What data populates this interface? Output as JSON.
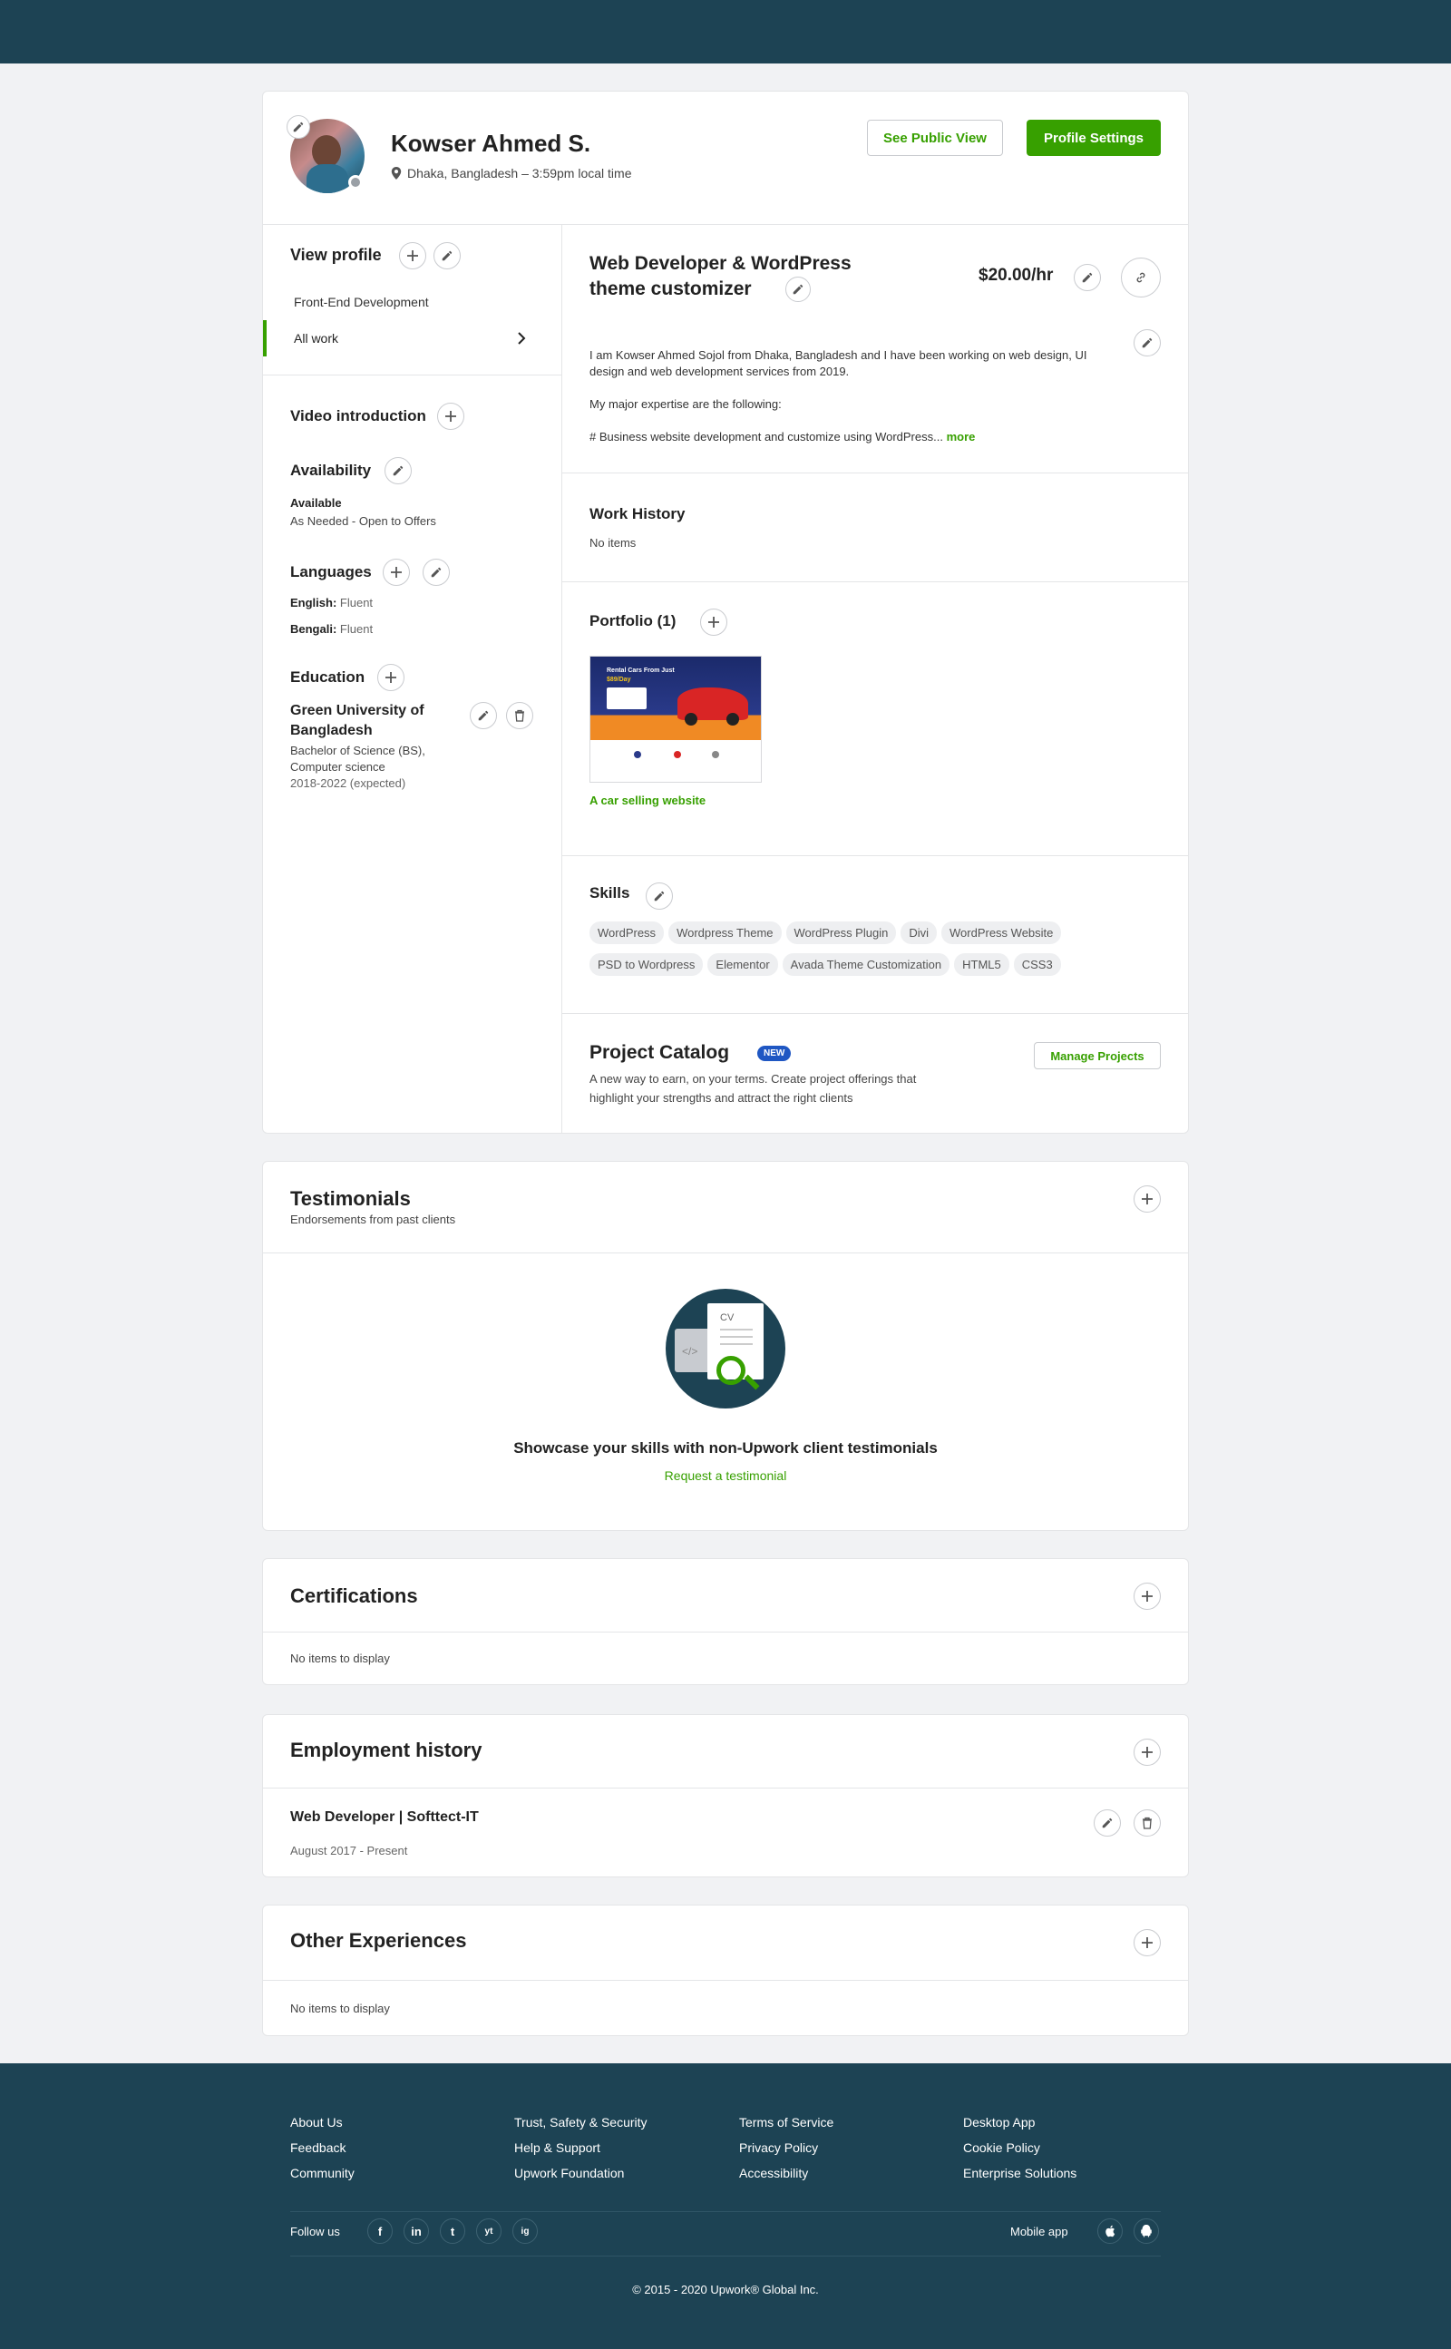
{
  "colors": {
    "brand": "#37a000",
    "header": "#1d4354",
    "badge_blue": "#1f57c3"
  },
  "profile": {
    "name": "Kowser Ahmed S.",
    "location": "Dhaka, Bangladesh – 3:59pm local time",
    "see_public_view": "See Public View",
    "profile_settings": "Profile Settings"
  },
  "sidebar": {
    "view_profile": "View profile",
    "items": [
      {
        "label": "Front-End Development"
      },
      {
        "label": "All work"
      }
    ],
    "video_intro": "Video introduction",
    "availability": {
      "title": "Availability",
      "status": "Available",
      "detail": "As Needed - Open to Offers"
    },
    "languages": {
      "title": "Languages",
      "list": [
        {
          "name": "English:",
          "level": "Fluent"
        },
        {
          "name": "Bengali:",
          "level": "Fluent"
        }
      ]
    },
    "education": {
      "title": "Education",
      "school_line1": "Green University of",
      "school_line2": "Bangladesh",
      "degree_line1": "Bachelor of Science (BS),",
      "degree_line2": "Computer science",
      "years": "2018-2022 (expected)"
    }
  },
  "main": {
    "title_line1": "Web Developer & WordPress",
    "title_line2": "theme customizer",
    "rate": "$20.00/hr",
    "overview_p1": "I am Kowser Ahmed Sojol from Dhaka, Bangladesh and I have been working on web design, UI design and web development services from 2019.",
    "overview_p2": "My major expertise are the following:",
    "overview_p3": "# Business website development and customize using WordPress...",
    "more": "more",
    "work_history": {
      "title": "Work History",
      "empty": "No items"
    },
    "portfolio": {
      "title": "Portfolio (1)",
      "item_title": "A car selling website",
      "thumb_text": "Rental Cars From Just",
      "thumb_price": "$89/Day"
    },
    "skills": {
      "title": "Skills",
      "row1": [
        "WordPress",
        "Wordpress Theme",
        "WordPress Plugin",
        "Divi",
        "WordPress Website"
      ],
      "row2": [
        "PSD to Wordpress",
        "Elementor",
        "Avada Theme Customization",
        "HTML5",
        "CSS3"
      ]
    },
    "project_catalog": {
      "title": "Project Catalog",
      "badge": "NEW",
      "desc_line1": "A new way to earn, on your terms. Create project offerings that",
      "desc_line2": "highlight your strengths and attract the right clients",
      "manage": "Manage Projects"
    }
  },
  "testimonials": {
    "title": "Testimonials",
    "subtitle": "Endorsements from past clients",
    "cv_label": "CV",
    "heading": "Showcase your skills with non-Upwork client testimonials",
    "link": "Request a testimonial"
  },
  "certifications": {
    "title": "Certifications",
    "empty": "No items to display"
  },
  "employment": {
    "title": "Employment history",
    "job": "Web Developer | Softtect-IT",
    "dates": "August 2017 - Present"
  },
  "other": {
    "title": "Other Experiences",
    "empty": "No items to display"
  },
  "footer": {
    "col1": [
      "About Us",
      "Feedback",
      "Community"
    ],
    "col2": [
      "Trust, Safety & Security",
      "Help & Support",
      "Upwork Foundation"
    ],
    "col3": [
      "Terms of Service",
      "Privacy Policy",
      "Accessibility"
    ],
    "col4": [
      "Desktop App",
      "Cookie Policy",
      "Enterprise Solutions"
    ],
    "follow_us": "Follow us",
    "social": [
      "f",
      "in",
      "t",
      "yt",
      "ig"
    ],
    "mobile_app": "Mobile app",
    "copyright": "© 2015 - 2020 Upwork® Global Inc."
  }
}
